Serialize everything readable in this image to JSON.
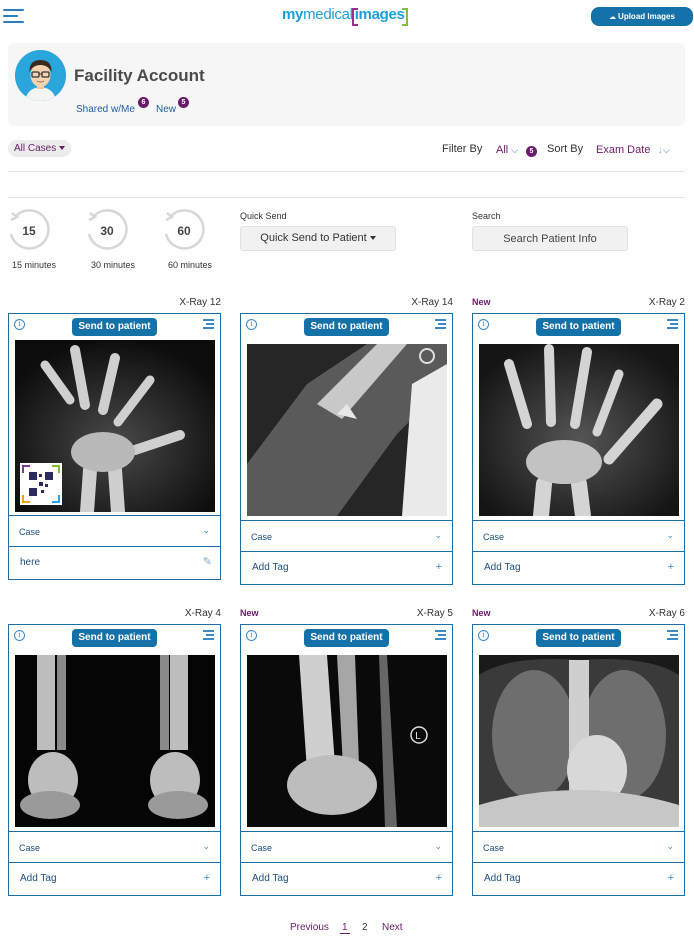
{
  "header": {
    "logo": {
      "my": "my",
      "medical": "medical",
      "images": "images"
    },
    "upload_label": "Upload Images",
    "upload_icon": "cloud-upload-icon"
  },
  "account": {
    "title": "Facility Account",
    "shared_label": "Shared w/Me",
    "shared_count": "6",
    "new_label": "New",
    "new_count": "5"
  },
  "filters": {
    "all_cases": "All Cases",
    "filter_by_label": "Filter By",
    "filter_value": "All",
    "filter_count": "5",
    "sort_by_label": "Sort By",
    "sort_value": "Exam Date",
    "sort_direction": "↓"
  },
  "quick_timers": [
    {
      "value": "15",
      "label": "15 minutes"
    },
    {
      "value": "30",
      "label": "30 minutes"
    },
    {
      "value": "60",
      "label": "60 minutes"
    }
  ],
  "quick_send": {
    "label": "Quick Send",
    "button": "Quick Send to Patient"
  },
  "search": {
    "label": "Search",
    "placeholder": "Search Patient Info"
  },
  "cards": [
    {
      "title": "X-Ray 12",
      "new": "",
      "send": "Send to patient",
      "case": "Case",
      "tag": "here",
      "tag_type": "edit"
    },
    {
      "title": "X-Ray 14",
      "new": "",
      "send": "Send to patient",
      "case": "Case",
      "tag": "Add Tag",
      "tag_type": "add"
    },
    {
      "title": "X-Ray 2",
      "new": "New",
      "send": "Send to patient",
      "case": "Case",
      "tag": "Add Tag",
      "tag_type": "add"
    },
    {
      "title": "X-Ray 4",
      "new": "",
      "send": "Send to patient",
      "case": "Case",
      "tag": "Add Tag",
      "tag_type": "add"
    },
    {
      "title": "X-Ray 5",
      "new": "New",
      "send": "Send to patient",
      "case": "Case",
      "tag": "Add Tag",
      "tag_type": "add"
    },
    {
      "title": "X-Ray 6",
      "new": "New",
      "send": "Send to patient",
      "case": "Case",
      "tag": "Add Tag",
      "tag_type": "add"
    }
  ],
  "pagination": {
    "previous": "Previous",
    "pages": [
      "1",
      "2"
    ],
    "current": "1",
    "next": "Next"
  },
  "colors": {
    "primary": "#1472a8",
    "accent": "#6a1b6a",
    "card_border": "#1f6da3"
  }
}
